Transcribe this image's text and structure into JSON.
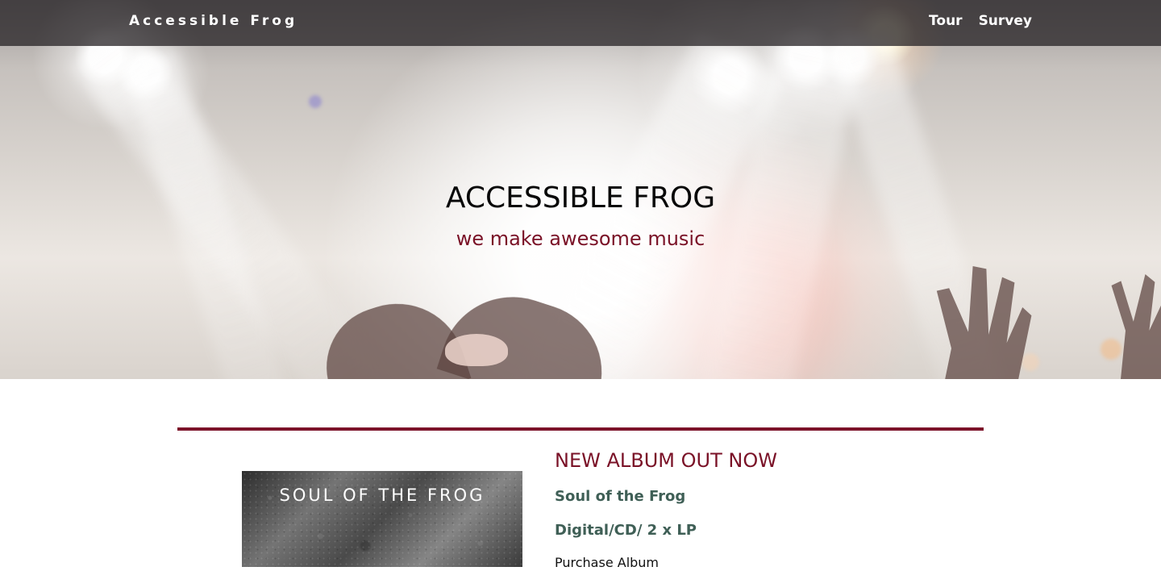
{
  "header": {
    "brand": "Accessible Frog",
    "nav": [
      {
        "label": "Tour"
      },
      {
        "label": "Survey"
      }
    ]
  },
  "hero": {
    "title": "ACCESSIBLE FROG",
    "tagline": "we make awesome music",
    "image_icon": "concert-crowd-image"
  },
  "album": {
    "cover_title": "SOUL OF THE FROG",
    "heading": "NEW ALBUM OUT NOW",
    "name": "Soul of the Frog",
    "formats": "Digital/CD/ 2 x LP",
    "purchase_label": "Purchase Album"
  },
  "colors": {
    "accent": "#7a1227",
    "navbar": "#282426",
    "subheading": "#3f5f56"
  }
}
